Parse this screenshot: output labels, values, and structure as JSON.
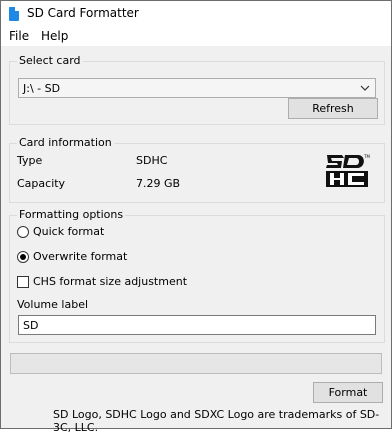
{
  "window": {
    "title": "SD Card Formatter"
  },
  "menu": {
    "items": [
      "File",
      "Help"
    ]
  },
  "select_card": {
    "legend": "Select card",
    "selected": "J:\\ - SD",
    "refresh_label": "Refresh"
  },
  "card_info": {
    "legend": "Card information",
    "type_label": "Type",
    "type_value": "SDHC",
    "capacity_label": "Capacity",
    "capacity_value": "7.29 GB",
    "logo": "sdhc-logo"
  },
  "formatting": {
    "legend": "Formatting options",
    "quick_label": "Quick format",
    "overwrite_label": "Overwrite format",
    "selected_option": "Overwrite format",
    "chs_label": "CHS format size adjustment",
    "chs_checked": false,
    "volume_label_title": "Volume label",
    "volume_label_value": "SD"
  },
  "progress": {
    "fraction": 0
  },
  "actions": {
    "format_label": "Format"
  },
  "footer": {
    "trademark": "SD Logo, SDHC Logo and SDXC Logo are trademarks of SD-3C, LLC."
  }
}
